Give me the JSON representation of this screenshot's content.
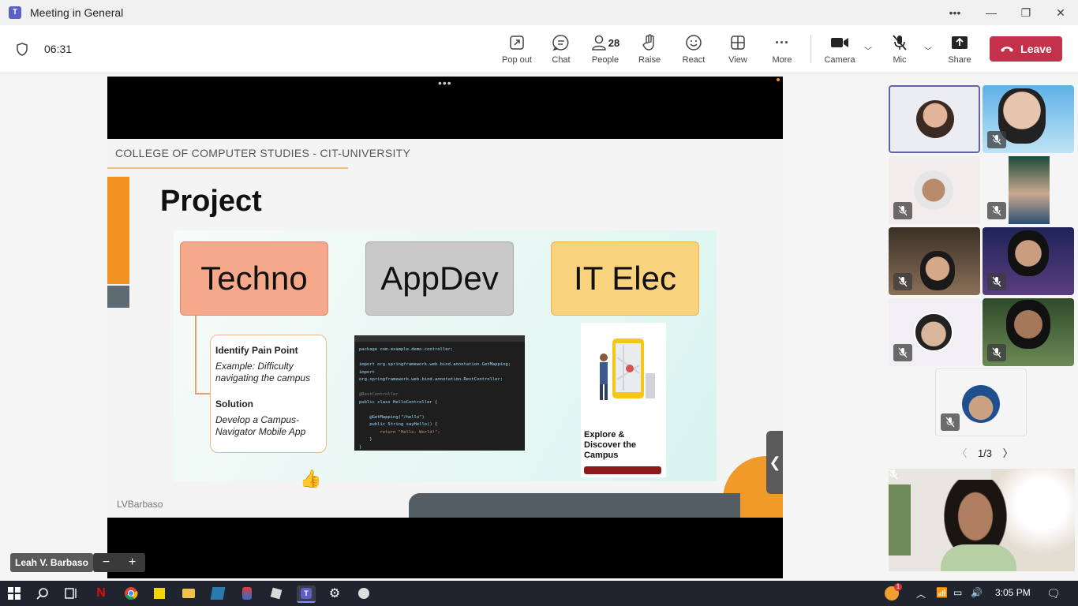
{
  "window": {
    "title": "Meeting in General",
    "app_logo": "T"
  },
  "meeting": {
    "timer": "06:31"
  },
  "toolbar": {
    "pop_out": "Pop out",
    "chat": "Chat",
    "people": "People",
    "people_count": "28",
    "raise": "Raise",
    "react": "React",
    "view": "View",
    "more": "More",
    "camera": "Camera",
    "mic": "Mic",
    "share": "Share",
    "leave": "Leave"
  },
  "slide": {
    "header": "COLLEGE OF COMPUTER STUDIES - CIT-UNIVERSITY",
    "title": "Project",
    "boxes": [
      "Techno",
      "AppDev",
      "IT Elec"
    ],
    "pain_heading": "Identify Pain Point",
    "pain_text": "Example: Difficulty navigating the campus",
    "solution_heading": "Solution",
    "solution_text": "Develop a Campus-Navigator Mobile App",
    "code_lines": [
      "package com.example.demo.controller;",
      "",
      "import org.springframework.web.bind.annotation.GetMapping;",
      "import org.springframework.web.bind.annotation.RestController;",
      "",
      "@RestController",
      "public class HelloController {",
      "",
      "    @GetMapping(\"/hello\")",
      "    public String sayHello() {",
      "        return \"Hello, World!\";",
      "    }",
      "}"
    ],
    "phone_text": "Explore & Discover the Campus",
    "watermark": "LVBarbaso"
  },
  "presenter": {
    "name": "Leah V. Barbaso"
  },
  "pager": {
    "label": "1/3"
  },
  "taskbar": {
    "time": "3:05 PM",
    "notification_count": "1"
  },
  "colors": {
    "accent": "#5b5fc7",
    "leave": "#c4314b",
    "slide_orange": "#f39221"
  },
  "icons": [
    "windows-start-icon",
    "search-icon",
    "task-view-icon",
    "netflix-icon",
    "chrome-icon",
    "sticky-notes-icon",
    "file-explorer-icon",
    "app-icon",
    "paint-icon",
    "roblox-icon",
    "teams-icon",
    "settings-icon",
    "shield-app-icon"
  ]
}
